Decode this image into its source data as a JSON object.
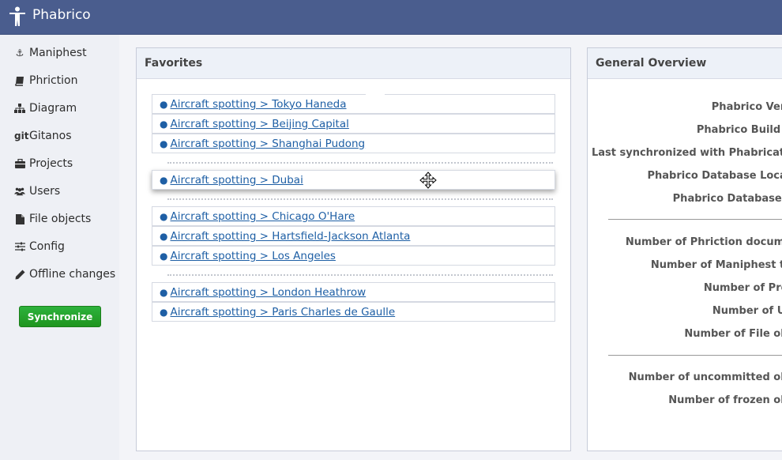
{
  "app": {
    "title": "Phabrico",
    "logo_icon": "person-icon"
  },
  "sidebar": {
    "items": [
      {
        "label": "Maniphest",
        "icon": "anchor-icon"
      },
      {
        "label": "Phriction",
        "icon": "book-icon"
      },
      {
        "label": "Diagram",
        "icon": "sitemap-icon"
      },
      {
        "label": "Gitanos",
        "icon": "git-icon",
        "icon_text": "git"
      },
      {
        "label": "Projects",
        "icon": "briefcase-icon"
      },
      {
        "label": "Users",
        "icon": "users-icon"
      },
      {
        "label": "File objects",
        "icon": "file-icon"
      },
      {
        "label": "Config",
        "icon": "sliders-icon"
      },
      {
        "label": "Offline changes",
        "icon": "pencil-icon"
      }
    ],
    "sync_button": "Synchronize",
    "accent": "#22a52c"
  },
  "favorites": {
    "title": "Favorites",
    "groups": [
      [
        "Aircraft spotting > Tokyo Haneda",
        "Aircraft spotting > Beijing Capital",
        "Aircraft spotting > Shanghai Pudong"
      ],
      [
        "Aircraft spotting > Dubai"
      ],
      [
        "Aircraft spotting > Chicago O'Hare",
        "Aircraft spotting > Hartsfield-Jackson Atlanta",
        "Aircraft spotting > Los Angeles"
      ],
      [
        "Aircraft spotting > London Heathrow",
        "Aircraft spotting > Paris Charles de Gaulle"
      ]
    ],
    "link_color": "#1e5fa5"
  },
  "overview": {
    "title": "General Overview",
    "rows": [
      "Phabrico Vers",
      "Phabrico Build d",
      "Last synchronized with Phabricato",
      "Phabrico Database Locat",
      "Phabrico Database s",
      "Number of Phriction docume",
      "Number of Maniphest ta",
      "Number of Proj",
      "Number of Us",
      "Number of File obj",
      "Number of uncommitted obj",
      "Number of frozen obj"
    ]
  }
}
